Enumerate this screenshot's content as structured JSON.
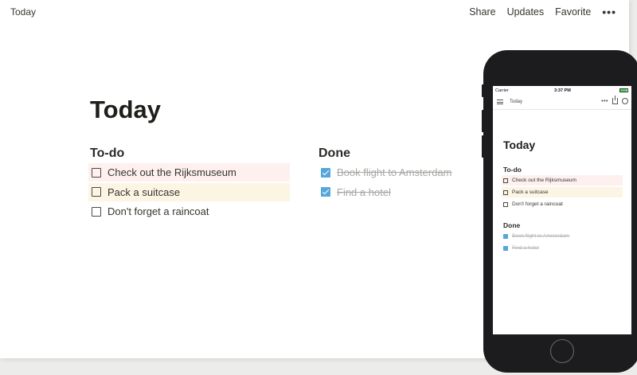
{
  "desktop": {
    "breadcrumb": "Today",
    "actions": {
      "share": "Share",
      "updates": "Updates",
      "favorite": "Favorite",
      "more": "•••"
    },
    "page_title": "Today",
    "todo": {
      "heading": "To-do",
      "items": [
        {
          "label": "Check out the Rijksmuseum",
          "checked": false,
          "highlight": "#fdf0ee"
        },
        {
          "label": "Pack a suitcase",
          "checked": false,
          "highlight": "#fdf5e4"
        },
        {
          "label": "Don't forget a raincoat",
          "checked": false,
          "highlight": ""
        }
      ]
    },
    "done": {
      "heading": "Done",
      "items": [
        {
          "label": "Book flight to Amsterdam",
          "checked": true
        },
        {
          "label": "Find a hotel",
          "checked": true
        }
      ]
    }
  },
  "mobile": {
    "status": {
      "carrier": "Carrier",
      "time": "3:37 PM"
    },
    "breadcrumb": "Today",
    "more": "•••",
    "page_title": "Today",
    "todo": {
      "heading": "To-do",
      "items": [
        {
          "label": "Check out the Rijksmuseum",
          "checked": false,
          "highlight": "#fdf0ee"
        },
        {
          "label": "Pack a suitcase",
          "checked": false,
          "highlight": "#fdf5e4"
        },
        {
          "label": "Don't forget a raincoat",
          "checked": false,
          "highlight": ""
        }
      ]
    },
    "done": {
      "heading": "Done",
      "items": [
        {
          "label": "Book flight to Amsterdam",
          "checked": true
        },
        {
          "label": "Find a hotel",
          "checked": true
        }
      ]
    }
  },
  "colors": {
    "checkbox_checked": "#55a7d9",
    "text": "#37352f"
  }
}
